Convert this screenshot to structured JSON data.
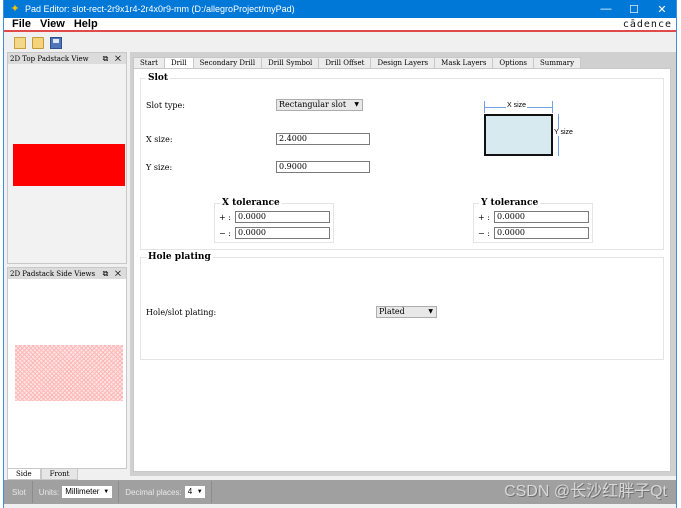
{
  "window": {
    "title": "Pad Editor: slot-rect-2r9x1r4-2r4x0r9-mm  (D:/allegroProject/myPad)",
    "controls": {
      "minimize": "—",
      "maximize": "☐",
      "close": "✕"
    }
  },
  "menu": {
    "items": [
      "File",
      "View",
      "Help"
    ],
    "brand": "cādence"
  },
  "toolbar": {
    "icons": [
      "new-file-icon",
      "open-folder-icon",
      "save-icon"
    ]
  },
  "top_view": {
    "title": "2D Top Padstack View",
    "float_icon": "⧉",
    "close_icon": "✕",
    "pad_color": "#ff0000"
  },
  "side_view": {
    "title": "2D Padstack Side Views",
    "float_icon": "⧉",
    "close_icon": "✕",
    "tabs": [
      "Side",
      "Front"
    ],
    "active_tab": "Side"
  },
  "tabs": {
    "items": [
      "Start",
      "Drill",
      "Secondary Drill",
      "Drill Symbol",
      "Drill Offset",
      "Design Layers",
      "Mask Layers",
      "Options",
      "Summary"
    ],
    "active": "Drill"
  },
  "slot": {
    "title": "Slot",
    "slot_type_label": "Slot type:",
    "slot_type_value": "Rectangular slot",
    "x_size_label": "X size:",
    "x_size_value": "2.4000",
    "y_size_label": "Y size:",
    "y_size_value": "0.9000",
    "diagram": {
      "x_label": "X size",
      "y_label": "Y size",
      "fill": "#d6eaf0"
    },
    "x_tolerance": {
      "title": "X tolerance",
      "plus_label": "+ :",
      "plus_value": "0.0000",
      "minus_label": "− :",
      "minus_value": "0.0000"
    },
    "y_tolerance": {
      "title": "Y tolerance",
      "plus_label": "+ :",
      "plus_value": "0.0000",
      "minus_label": "− :",
      "minus_value": "0.0000"
    }
  },
  "hole_plating": {
    "title": "Hole plating",
    "label": "Hole/slot plating:",
    "value": "Plated"
  },
  "statusbar": {
    "mode": "Slot",
    "units_label": "Units:",
    "units_value": "Millimeter",
    "decimal_label": "Decimal places:",
    "decimal_value": "4"
  },
  "watermark": "CSDN @长沙红胖子Qt"
}
